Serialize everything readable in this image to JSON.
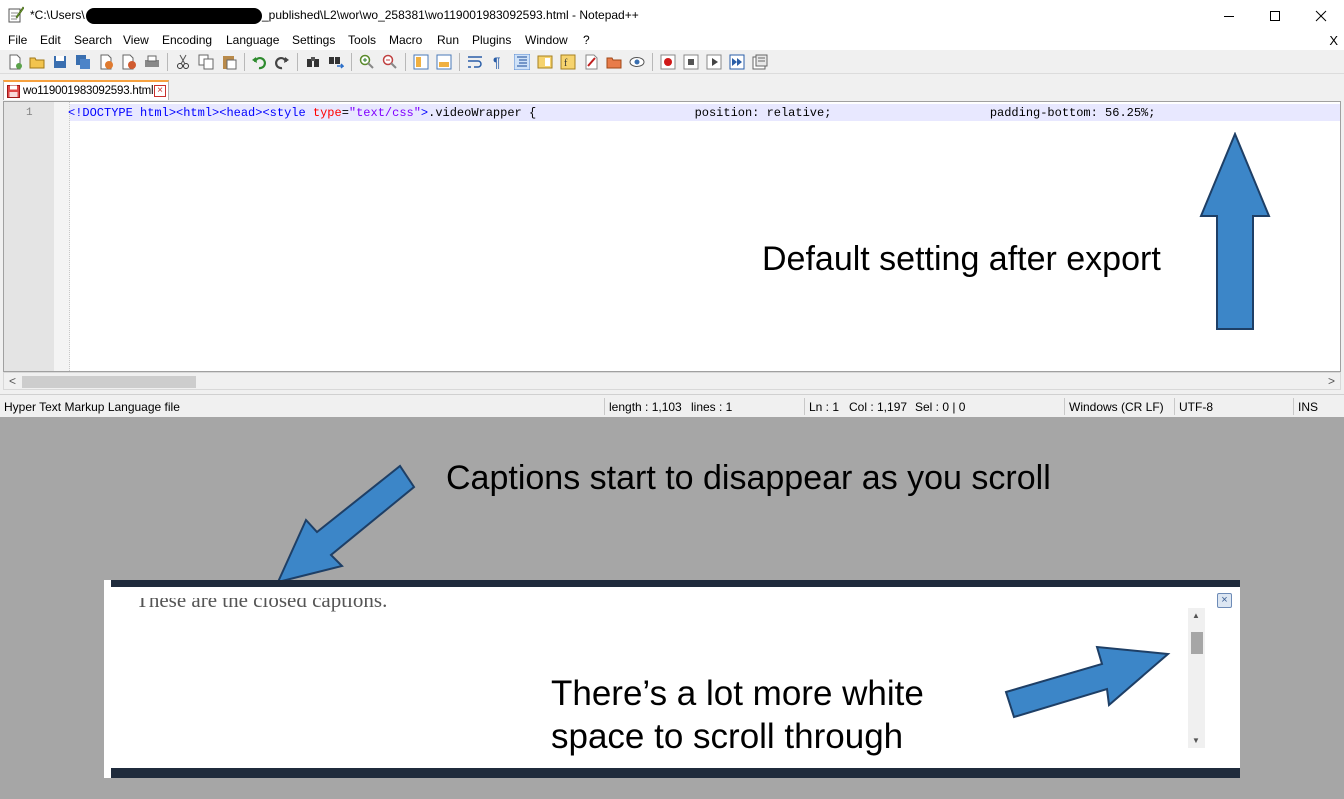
{
  "window": {
    "title_prefix": "*C:\\Users\\",
    "title_suffix": "_published\\L2\\wor\\wo_258381\\wo119001983092593.html - Notepad++",
    "controls": [
      "minimize-icon",
      "maximize-icon",
      "close-icon"
    ]
  },
  "menu": {
    "items": [
      "File",
      "Edit",
      "Search",
      "View",
      "Encoding",
      "Language",
      "Settings",
      "Tools",
      "Macro",
      "Run",
      "Plugins",
      "Window",
      "?"
    ],
    "close_label": "X"
  },
  "toolbar": {
    "icons": [
      "new-file-icon",
      "open-file-icon",
      "save-icon",
      "save-all-icon",
      "close-icon",
      "close-all-icon",
      "print-icon",
      "cut-icon",
      "copy-icon",
      "paste-icon",
      "undo-icon",
      "redo-icon",
      "find-icon",
      "replace-icon",
      "zoom-in-icon",
      "zoom-out-icon",
      "sync-vertical-icon",
      "sync-horizontal-icon",
      "word-wrap-icon",
      "show-all-chars-icon",
      "indent-guide-icon",
      "doc-map-icon",
      "function-list-icon",
      "folder-workspace-icon",
      "monitor-icon",
      "record-macro-icon",
      "stop-record-icon",
      "play-macro-icon",
      "run-macro-multiple-icon",
      "save-macro-icon"
    ]
  },
  "tab": {
    "label": "wo119001983092593.html"
  },
  "editor": {
    "line_number": "1",
    "code_tokens": [
      {
        "t": "<!DOCTYPE html>",
        "c": "tag"
      },
      {
        "t": "<html>",
        "c": "tag"
      },
      {
        "t": "<head>",
        "c": "tag"
      },
      {
        "t": "<style ",
        "c": "tag"
      },
      {
        "t": "type",
        "c": "attr"
      },
      {
        "t": "=",
        "c": "css"
      },
      {
        "t": "\"text/css\"",
        "c": "str"
      },
      {
        "t": ">",
        "c": "tag"
      },
      {
        "t": ".videoWrapper {                      position: relative;                      padding-bottom: 56.25%;",
        "c": "css"
      }
    ]
  },
  "status": {
    "file_type": "Hyper Text Markup Language file",
    "length": "length : 1,103",
    "lines": "lines : 1",
    "ln": "Ln : 1",
    "col": "Col : 1,197",
    "sel": "Sel : 0 | 0",
    "eol": "Windows (CR LF)",
    "encoding": "UTF-8",
    "mode": "INS"
  },
  "annotations": {
    "default_setting": "Default setting after export",
    "captions_disappear": "Captions start to disappear as you scroll",
    "white_space_line1": "There’s a lot more white",
    "white_space_line2": "space to scroll through"
  },
  "player": {
    "caption": "These are the closed captions.",
    "close_symbol": "×"
  },
  "colors": {
    "arrow_fill": "#3c86c8",
    "arrow_stroke": "#1e3f66",
    "player_bar": "#1f2b3c",
    "background": "#a6a6a6"
  }
}
